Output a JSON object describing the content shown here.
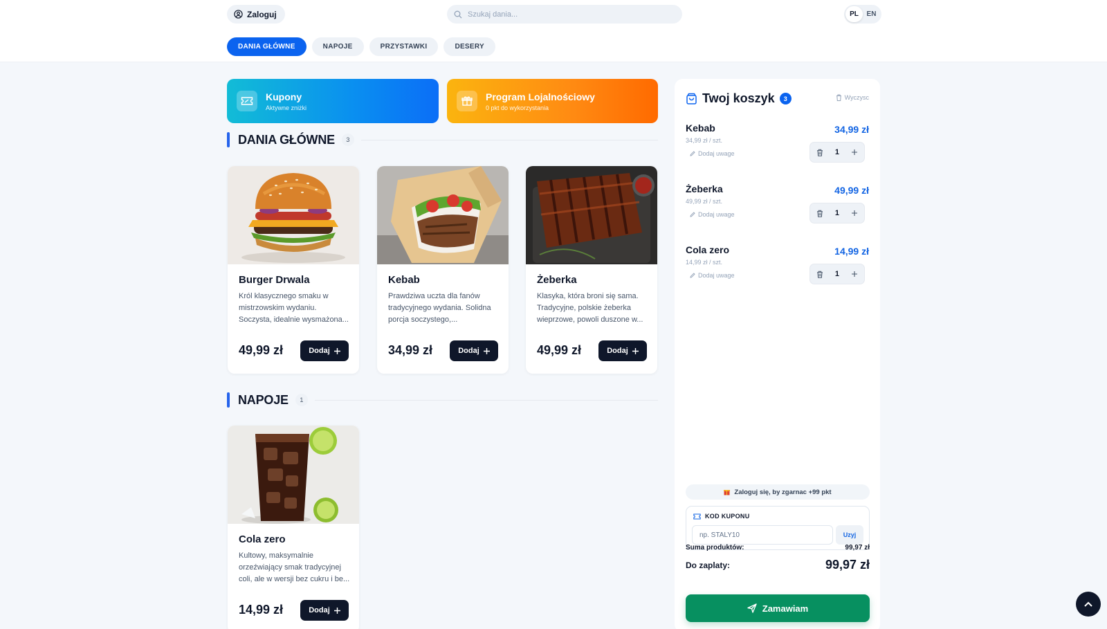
{
  "header": {
    "login_label": "Zaloguj",
    "search_placeholder": "Szukaj dania...",
    "languages": [
      "PL",
      "EN"
    ],
    "active_language": "PL"
  },
  "tabs": [
    {
      "label": "DANIA GŁÓWNE",
      "active": true
    },
    {
      "label": "NAPOJE",
      "active": false
    },
    {
      "label": "PRZYSTAWKI",
      "active": false
    },
    {
      "label": "DESERY",
      "active": false
    }
  ],
  "promos": {
    "coupons": {
      "title": "Kupony",
      "subtitle": "Aktywne zniżki"
    },
    "loyalty": {
      "title": "Program Lojalnościowy",
      "subtitle": "0 pkt do wykorzystania"
    }
  },
  "sections": [
    {
      "title": "DANIA GŁÓWNE",
      "count": "3",
      "products": [
        {
          "name": "Burger Drwala",
          "description": "Król klasycznego smaku w mistrzowskim wydaniu. Soczysta, idealnie wysmażona...",
          "price": "49,99 zł",
          "add_label": "Dodaj",
          "image": "burger"
        },
        {
          "name": "Kebab",
          "description": "Prawdziwa uczta dla fanów tradycyjnego wydania. Solidna porcja soczystego,...",
          "price": "34,99 zł",
          "add_label": "Dodaj",
          "image": "kebab-wrap"
        },
        {
          "name": "Żeberka",
          "description": "Klasyka, która broni się sama. Tradycyjne, polskie żeberka wieprzowe, powoli duszone w...",
          "price": "49,99 zł",
          "add_label": "Dodaj",
          "image": "ribs"
        }
      ]
    },
    {
      "title": "NAPOJE",
      "count": "1",
      "products": [
        {
          "name": "Cola zero",
          "description": "Kultowy, maksymalnie orzeźwiający smak tradycyjnej coli, ale w wersji bez cukru i be...",
          "price": "14,99 zł",
          "add_label": "Dodaj",
          "image": "cola-glass"
        }
      ]
    }
  ],
  "cart": {
    "title": "Twoj koszyk",
    "count": "3",
    "clear_label": "Wyczysc",
    "note_label": "Dodaj uwage",
    "items": [
      {
        "name": "Kebab",
        "unit_price": "34,99 zł / szt.",
        "total": "34,99 zł",
        "qty": "1"
      },
      {
        "name": "Żeberka",
        "unit_price": "49,99 zł / szt.",
        "total": "49,99 zł",
        "qty": "1"
      },
      {
        "name": "Cola zero",
        "unit_price": "14,99 zł / szt.",
        "total": "14,99 zł",
        "qty": "1"
      }
    ],
    "loyalty_note": "Zaloguj się, by zgarnac +99 pkt",
    "coupon": {
      "label": "KOD KUPONU",
      "placeholder": "np. STALY10",
      "apply_label": "Uzyj"
    },
    "subtotal_label": "Suma produktów:",
    "subtotal_value": "99,97 zł",
    "due_label": "Do zaplaty:",
    "due_value": "99,97 zł",
    "order_label": "Zamawiam"
  },
  "colors": {
    "accent": "#0b63ef",
    "order": "#079060",
    "dark": "#0f172a"
  }
}
